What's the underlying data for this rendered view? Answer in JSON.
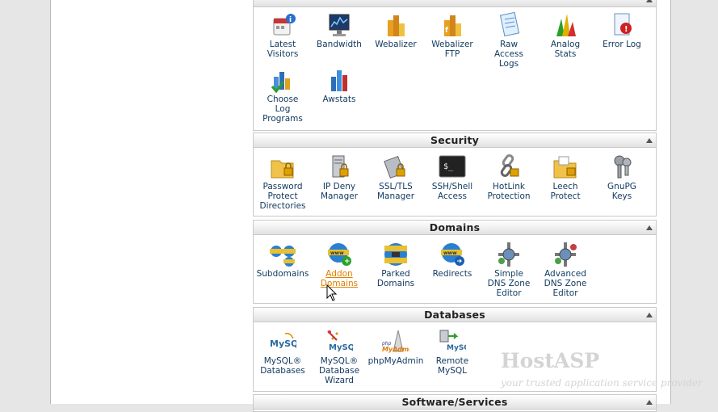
{
  "logs": {
    "items": [
      {
        "label": "Latest\nVisitors",
        "icon": "latest-visitors-icon"
      },
      {
        "label": "Bandwidth",
        "icon": "bandwidth-icon"
      },
      {
        "label": "Webalizer",
        "icon": "webalizer-icon"
      },
      {
        "label": "Webalizer\nFTP",
        "icon": "webalizer-ftp-icon"
      },
      {
        "label": "Raw\nAccess\nLogs",
        "icon": "raw-access-logs-icon"
      },
      {
        "label": "Analog\nStats",
        "icon": "analog-stats-icon"
      },
      {
        "label": "Error Log",
        "icon": "error-log-icon"
      },
      {
        "label": "Choose\nLog\nPrograms",
        "icon": "choose-log-programs-icon"
      },
      {
        "label": "Awstats",
        "icon": "awstats-icon"
      }
    ]
  },
  "security": {
    "title": "Security",
    "items": [
      {
        "label": "Password\nProtect\nDirectories",
        "icon": "password-folder-icon"
      },
      {
        "label": "IP Deny\nManager",
        "icon": "ip-deny-icon"
      },
      {
        "label": "SSL/TLS\nManager",
        "icon": "ssl-tls-icon"
      },
      {
        "label": "SSH/Shell\nAccess",
        "icon": "ssh-terminal-icon"
      },
      {
        "label": "HotLink\nProtection",
        "icon": "hotlink-chain-icon"
      },
      {
        "label": "Leech\nProtect",
        "icon": "leech-folder-icon"
      },
      {
        "label": "GnuPG\nKeys",
        "icon": "keys-icon"
      }
    ]
  },
  "domains": {
    "title": "Domains",
    "items": [
      {
        "label": "Subdomains",
        "icon": "subdomains-www-icon"
      },
      {
        "label": "Addon\nDomains",
        "icon": "addon-domains-www-icon"
      },
      {
        "label": "Parked\nDomains",
        "icon": "parked-domains-www-icon"
      },
      {
        "label": "Redirects",
        "icon": "redirects-www-icon"
      },
      {
        "label": "Simple\nDNS Zone\nEditor",
        "icon": "simple-dns-icon"
      },
      {
        "label": "Advanced\nDNS Zone\nEditor",
        "icon": "advanced-dns-icon"
      }
    ]
  },
  "databases": {
    "title": "Databases",
    "items": [
      {
        "label": "MySQL®\nDatabases",
        "icon": "mysql-icon"
      },
      {
        "label": "MySQL®\nDatabase\nWizard",
        "icon": "mysql-wizard-icon"
      },
      {
        "label": "phpMyAdmin",
        "icon": "phpmyadmin-icon"
      },
      {
        "label": "Remote\nMySQL",
        "icon": "remote-mysql-icon"
      }
    ]
  },
  "software": {
    "title": "Software/Services"
  },
  "watermark": {
    "brand": "HostASP",
    "tagline": "your trusted application service provider"
  },
  "colors": {
    "link": "#10385f",
    "hover_link": "#e07f00",
    "panel_border": "#c9c9c9"
  }
}
